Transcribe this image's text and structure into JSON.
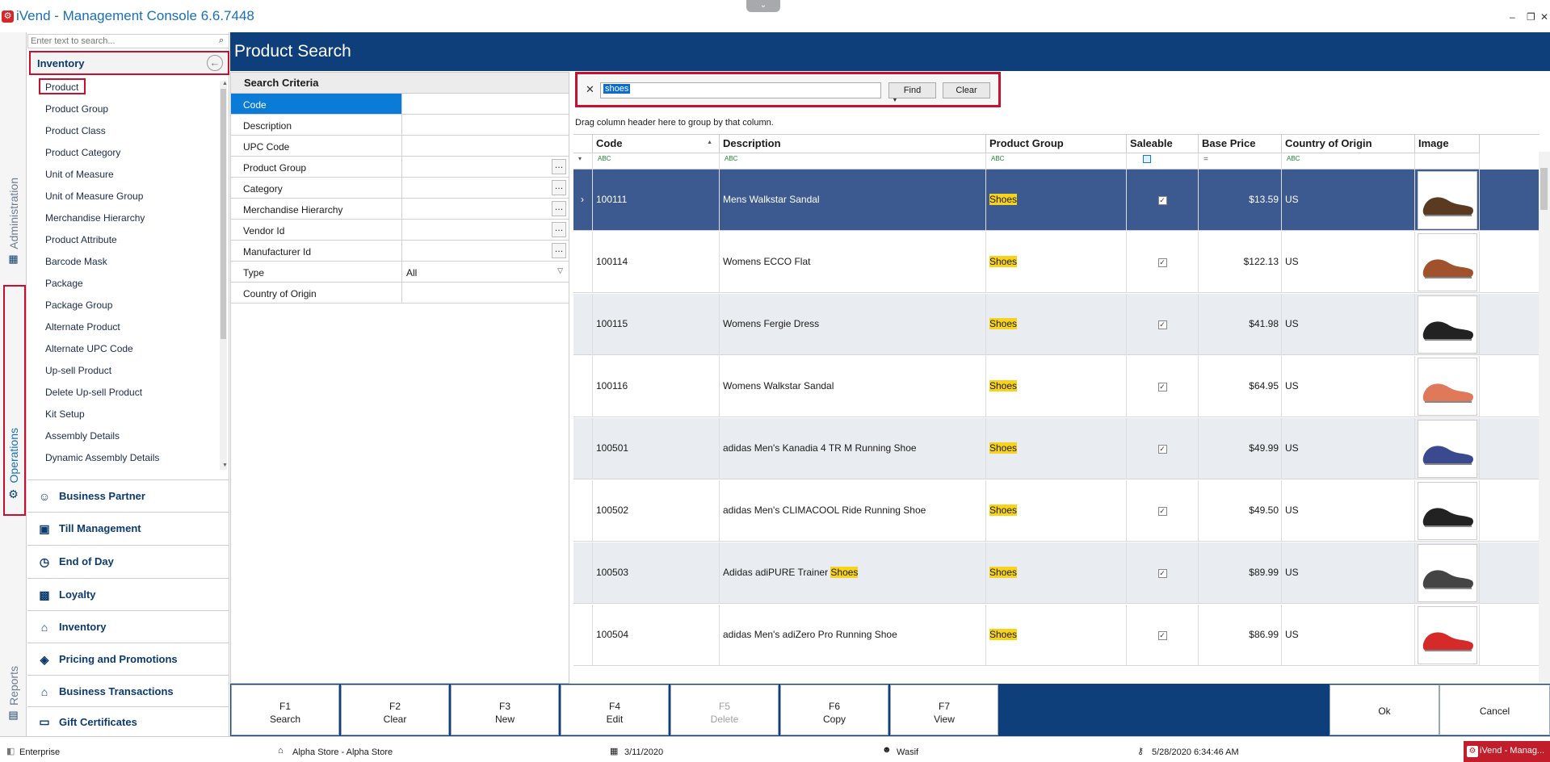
{
  "window": {
    "title": "iVend - Management Console  6.6.7448"
  },
  "nav": {
    "search_placeholder": "Enter text to search...",
    "header": "Inventory",
    "items": [
      "Product",
      "Product Group",
      "Product Class",
      "Product Category",
      "Unit of Measure",
      "Unit of Measure Group",
      "Merchandise Hierarchy",
      "Product Attribute",
      "Barcode Mask",
      "Package",
      "Package Group",
      "Alternate Product",
      "Alternate UPC Code",
      "Up-sell Product",
      "Delete Up-sell Product",
      "Kit Setup",
      "Assembly Details",
      "Dynamic Assembly Details"
    ],
    "sections": [
      "Business Partner",
      "Till Management",
      "End of Day",
      "Loyalty",
      "Inventory",
      "Pricing and Promotions",
      "Business Transactions",
      "Gift Certificates"
    ]
  },
  "vtabs": {
    "administration": "Administration",
    "operations": "Operations",
    "reports": "Reports"
  },
  "page": {
    "title": "Product Search"
  },
  "criteria": {
    "heading": "Search Criteria",
    "rows": [
      {
        "label": "Code",
        "value": ""
      },
      {
        "label": "Description",
        "value": ""
      },
      {
        "label": "UPC Code",
        "value": ""
      },
      {
        "label": "Product Group",
        "value": ""
      },
      {
        "label": "Category",
        "value": ""
      },
      {
        "label": "Merchandise Hierarchy",
        "value": ""
      },
      {
        "label": "Vendor Id",
        "value": ""
      },
      {
        "label": "Manufacturer Id",
        "value": ""
      },
      {
        "label": "Type",
        "value": "All"
      },
      {
        "label": "Country of Origin",
        "value": ""
      }
    ]
  },
  "search": {
    "value": "shoes",
    "find_label": "Find",
    "clear_label": "Clear",
    "group_hint": "Drag column header here to group by that column."
  },
  "grid": {
    "columns": [
      "Code",
      "Description",
      "Product Group",
      "Saleable",
      "Base Price",
      "Country of Origin",
      "Image"
    ],
    "rows": [
      {
        "code": "100111",
        "description": "Mens Walkstar Sandal",
        "group": "Shoes",
        "saleable": true,
        "price": "$13.59",
        "country": "US"
      },
      {
        "code": "100114",
        "description": "Womens ECCO Flat",
        "group": "Shoes",
        "saleable": true,
        "price": "$122.13",
        "country": "US"
      },
      {
        "code": "100115",
        "description": "Womens Fergie Dress",
        "group": "Shoes",
        "saleable": true,
        "price": "$41.98",
        "country": "US"
      },
      {
        "code": "100116",
        "description": "Womens Walkstar Sandal",
        "group": "Shoes",
        "saleable": true,
        "price": "$64.95",
        "country": "US"
      },
      {
        "code": "100501",
        "description": "adidas Men's Kanadia 4 TR M Running Shoe",
        "group": "Shoes",
        "saleable": true,
        "price": "$49.99",
        "country": "US"
      },
      {
        "code": "100502",
        "description": "adidas Men's CLIMACOOL Ride Running Shoe",
        "group": "Shoes",
        "saleable": true,
        "price": "$49.50",
        "country": "US"
      },
      {
        "code": "100503",
        "description": "Adidas adiPURE Trainer Shoes",
        "group": "Shoes",
        "saleable": true,
        "price": "$89.99",
        "country": "US"
      },
      {
        "code": "100504",
        "description": "adidas Men's adiZero Pro Running Shoe",
        "group": "Shoes",
        "saleable": true,
        "price": "$86.99",
        "country": "US"
      }
    ]
  },
  "fkeys": [
    {
      "key": "F1",
      "label": "Search",
      "enabled": true
    },
    {
      "key": "F2",
      "label": "Clear",
      "enabled": true
    },
    {
      "key": "F3",
      "label": "New",
      "enabled": true
    },
    {
      "key": "F4",
      "label": "Edit",
      "enabled": true
    },
    {
      "key": "F5",
      "label": "Delete",
      "enabled": false
    },
    {
      "key": "F6",
      "label": "Copy",
      "enabled": true
    },
    {
      "key": "F7",
      "label": "View",
      "enabled": true
    }
  ],
  "actions": {
    "ok_label": "Ok",
    "cancel_label": "Cancel"
  },
  "status": {
    "edition": "Enterprise",
    "store": "Alpha Store - Alpha Store",
    "business_date": "3/11/2020",
    "user": "Wasif",
    "datetime": "5/28/2020 6:34:46 AM",
    "taskbar_label": "iVend - Manag..."
  },
  "colors": {
    "header_band": "#0e3f7a",
    "highlight": "#f7d31a",
    "selected_row": "#3c5a8f",
    "callout_red": "#c8102e"
  }
}
